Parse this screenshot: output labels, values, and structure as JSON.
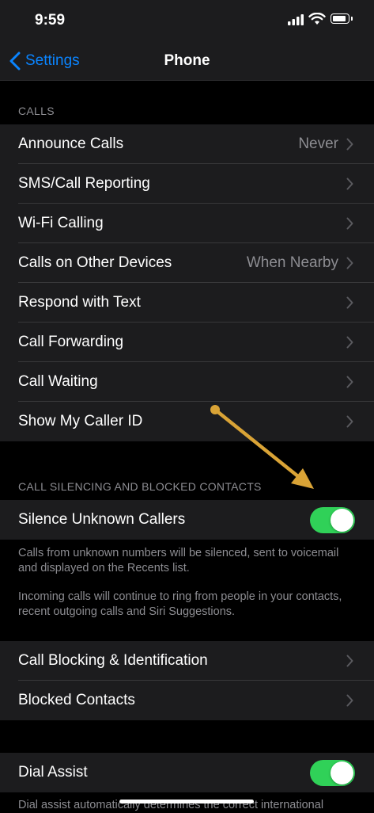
{
  "status": {
    "time": "9:59"
  },
  "nav": {
    "back_label": "Settings",
    "title": "Phone"
  },
  "calls_section": {
    "header": "CALLS",
    "rows": [
      {
        "label": "Announce Calls",
        "value": "Never"
      },
      {
        "label": "SMS/Call Reporting",
        "value": ""
      },
      {
        "label": "Wi-Fi Calling",
        "value": ""
      },
      {
        "label": "Calls on Other Devices",
        "value": "When Nearby"
      },
      {
        "label": "Respond with Text",
        "value": ""
      },
      {
        "label": "Call Forwarding",
        "value": ""
      },
      {
        "label": "Call Waiting",
        "value": ""
      },
      {
        "label": "Show My Caller ID",
        "value": ""
      }
    ]
  },
  "silencing_section": {
    "header": "CALL SILENCING AND BLOCKED CONTACTS",
    "toggle_row": {
      "label": "Silence Unknown Callers",
      "on": true
    },
    "footer_1": "Calls from unknown numbers will be silenced, sent to voicemail and displayed on the Recents list.",
    "footer_2": "Incoming calls will continue to ring from people in your contacts, recent outgoing calls and Siri Suggestions."
  },
  "blocking_section": {
    "rows": [
      {
        "label": "Call Blocking & Identification"
      },
      {
        "label": "Blocked Contacts"
      }
    ]
  },
  "dial_section": {
    "toggle_row": {
      "label": "Dial Assist",
      "on": true
    },
    "footer": "Dial assist automatically determines the correct international"
  },
  "colors": {
    "accent": "#0a84ff",
    "toggle_on": "#30d158",
    "annotation_arrow": "#d9a336",
    "cell_bg": "#1c1c1e",
    "secondary_text": "#8d8d92"
  },
  "icons": [
    "signal-icon",
    "wifi-icon",
    "battery-icon",
    "chevron-left-icon",
    "chevron-right-icon",
    "annotation-arrow-icon"
  ]
}
